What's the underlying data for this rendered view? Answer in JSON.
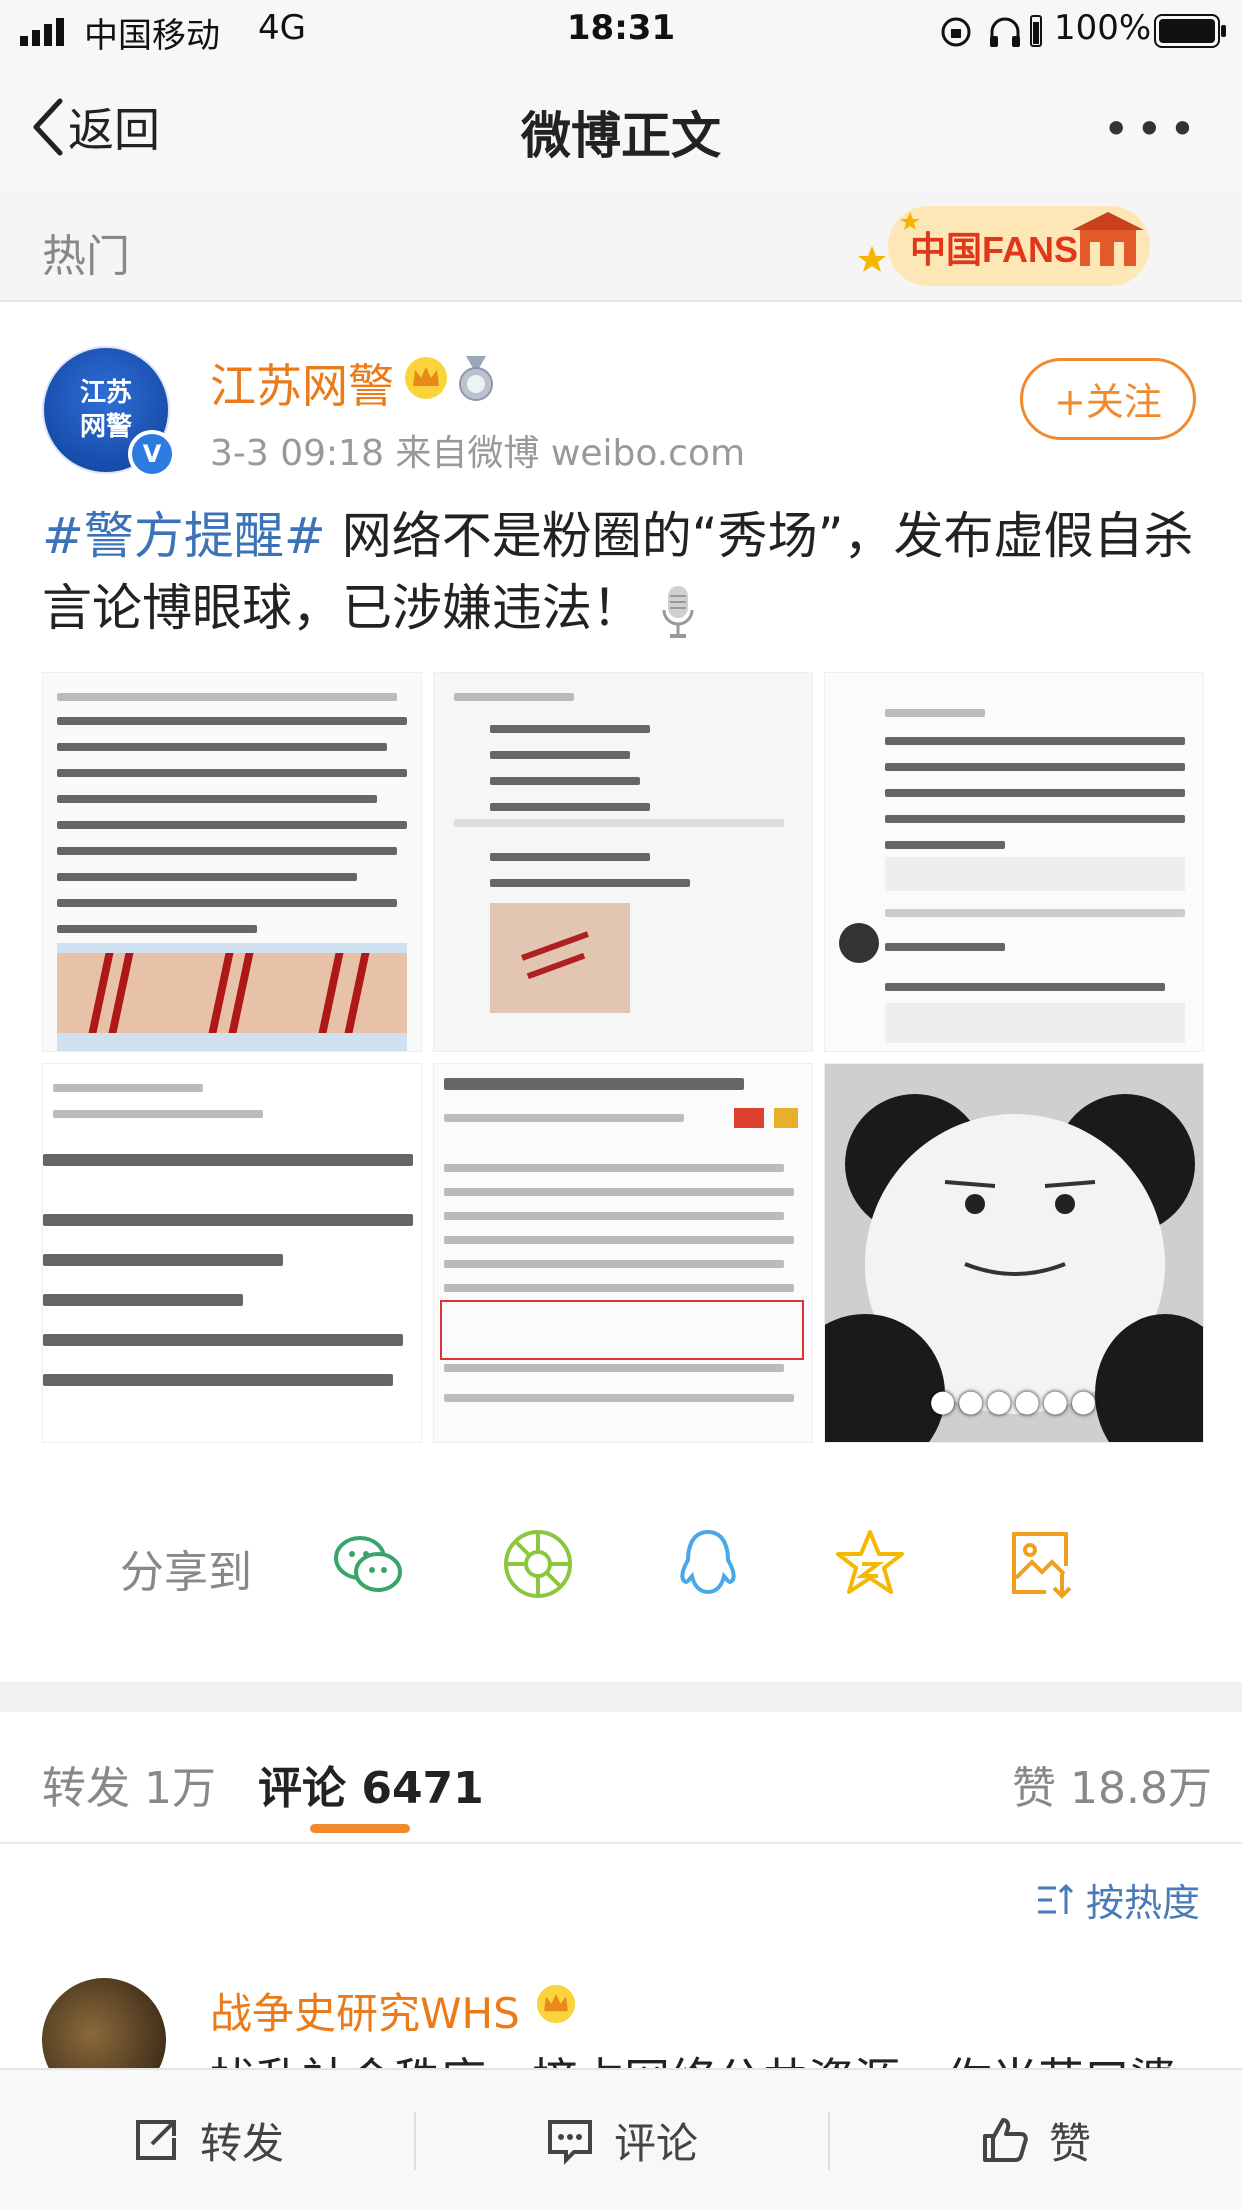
{
  "status_bar": {
    "carrier": "中国移动",
    "network": "4G",
    "time": "18:31",
    "battery": "100%"
  },
  "nav": {
    "back_label": "返回",
    "title": "微博正文",
    "more": "•••"
  },
  "hot_section": {
    "label": "热门",
    "badge_text": "中国FANS"
  },
  "post": {
    "avatar_text": "江苏\n网警",
    "author": "江苏网警",
    "meta": "3-3 09:18  来自微博 weibo.com",
    "follow_label": "+关注",
    "hashtag": "#警方提醒#",
    "text": " 网络不是粉圈的“秀场”，发布虚假自杀言论博眼球，已涉嫌违法！",
    "more_images": "●●●●●●"
  },
  "share": {
    "label": "分享到",
    "targets": [
      "wechat-icon",
      "moments-icon",
      "qq-icon",
      "qzone-icon",
      "save-image-icon"
    ]
  },
  "tabs": {
    "repost_label": "转发",
    "repost_count": "1万",
    "comment_label": "评论",
    "comment_count": "6471",
    "like_label": "赞",
    "like_count": "18.8万"
  },
  "sort_label": "按热度",
  "comment": {
    "name": "战争史研究WHS",
    "text": "扰乱社会秩序，挤占网络公共资源，你当苦口婆"
  },
  "bottom_bar": {
    "repost": "转发",
    "comment": "评论",
    "like": "赞"
  },
  "colors": {
    "accent_orange": "#f08a2d",
    "link_blue": "#3b73b9",
    "name_orange": "#eb7b18"
  }
}
